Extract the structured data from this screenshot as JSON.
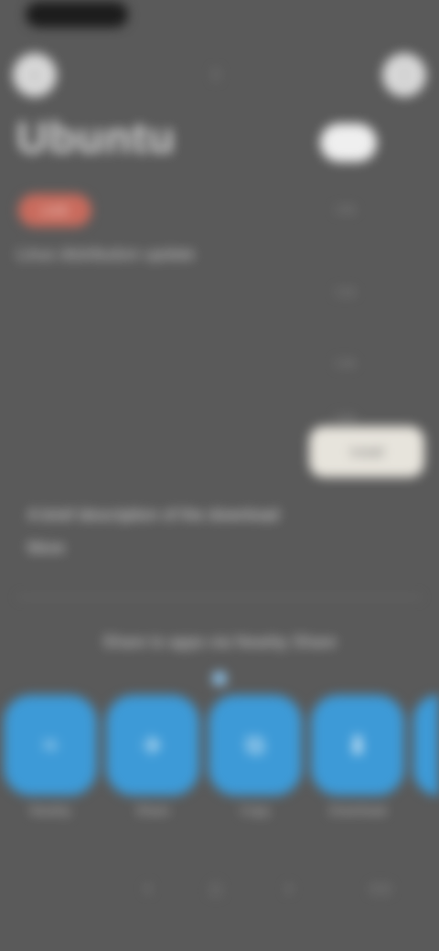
{
  "header": {
    "back_icon": "back-icon",
    "center_icon": "share-icon",
    "menu_icon": "more-icon",
    "title": "Ubuntu"
  },
  "badge": {
    "label": "LIVE"
  },
  "subtitle": "Linux distribution update",
  "right_column": {
    "items": [
      "1.0x",
      "1.2x",
      "1.4x",
      "1.6x"
    ],
    "action_label": "Install"
  },
  "description": "A brief description of the download",
  "description_more": "More",
  "share": {
    "title": "Share to apps via Nearby Share",
    "apps": [
      {
        "name": "Nearby",
        "icon": "nearby-icon"
      },
      {
        "name": "Share",
        "icon": "send-icon"
      },
      {
        "name": "Copy",
        "icon": "copy-icon"
      },
      {
        "name": "Download",
        "icon": "download-icon"
      },
      {
        "name": "More",
        "icon": "more-icon"
      }
    ]
  },
  "toolbar": {
    "icons": [
      "back-icon",
      "home-icon",
      "forward-icon",
      "tabs-icon"
    ]
  }
}
